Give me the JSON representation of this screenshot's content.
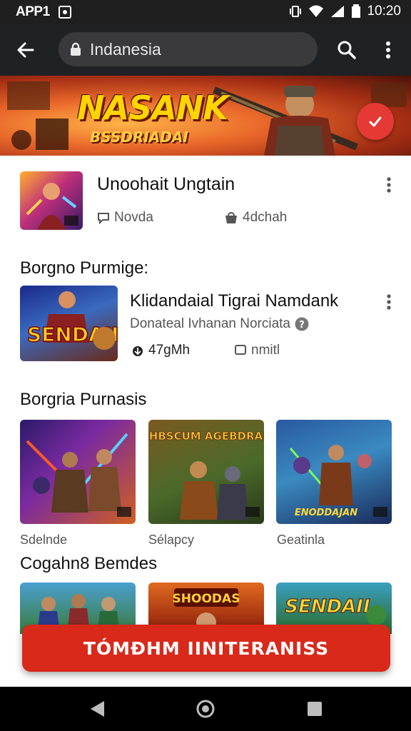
{
  "status_bar": {
    "carrier": "APP1",
    "time": "10:20"
  },
  "toolbar": {
    "url": "Indanesia"
  },
  "banner": {
    "title": "NASANK",
    "subtitle": "BSSDRIADAI"
  },
  "featured": {
    "title": "Unoohait Ungtain",
    "meta_left": "Novda",
    "meta_right": "4dchah"
  },
  "section1": {
    "title": "Borgno Purmige:",
    "item": {
      "title": "Klidandaial Tigrai Namdank",
      "subtitle": "Donateal Ivhanan Norciata",
      "stat_left": "47gMh",
      "stat_right": "nmitl",
      "thumb_text": "SENDAII"
    }
  },
  "section2": {
    "title": "Borgria Purnasis",
    "cards": [
      {
        "label": "Sdelnde"
      },
      {
        "label": "Sélapcy",
        "art_text": "BHBSCUM AGEBDRAN"
      },
      {
        "label": "Geatinla",
        "art_text": "ENODDAJAN"
      }
    ]
  },
  "section3": {
    "title": "Cogahn8 Bemdes",
    "cards": [
      {
        "art_text": ""
      },
      {
        "art_text": "SHOODAS"
      },
      {
        "art_text": "SENDAII"
      }
    ]
  },
  "cta": {
    "label": "TÓMÐHM IINITERANISS"
  },
  "colors": {
    "accent": "#d9291b",
    "toolbar": "#202124",
    "statusbar": "#1f1f1f"
  }
}
